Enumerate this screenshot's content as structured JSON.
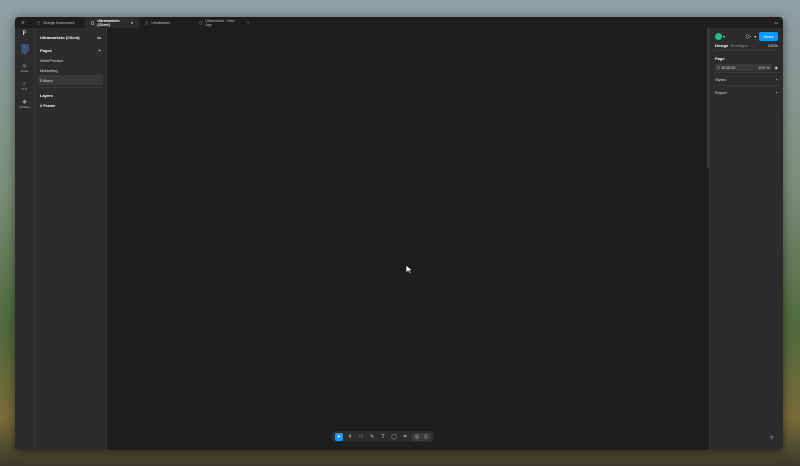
{
  "tabs": [
    {
      "label": "Bologic Businesses"
    },
    {
      "label": "Ultramarketo (Client)"
    },
    {
      "label": "UltraMarket"
    },
    {
      "label": "Ultramarket - Web App"
    }
  ],
  "rail": [
    {
      "label": "File",
      "icon": "file-icon"
    },
    {
      "label": "Assets",
      "icon": "assets-icon"
    },
    {
      "label": "Find",
      "icon": "find-icon"
    },
    {
      "label": "Variables",
      "icon": "variables-icon"
    }
  ],
  "file_name": "Ultramarketo (Client)",
  "pages": {
    "title": "Pages",
    "items": [
      "Web/Product",
      "Marketing",
      "Editors"
    ]
  },
  "layers": {
    "title": "Layers",
    "items": [
      "Frame"
    ]
  },
  "right": {
    "share": "Share",
    "tabs": [
      "Design",
      "Prototype"
    ],
    "zoom": "100%",
    "page_title": "Page",
    "bg_color": "1E1E1E",
    "bg_opacity": "100",
    "opacity_unit": "%",
    "styles": "Styles",
    "export": "Export"
  },
  "help": "?",
  "colors": {
    "accent": "#0d99ff",
    "avatar": "#1bc47d"
  }
}
